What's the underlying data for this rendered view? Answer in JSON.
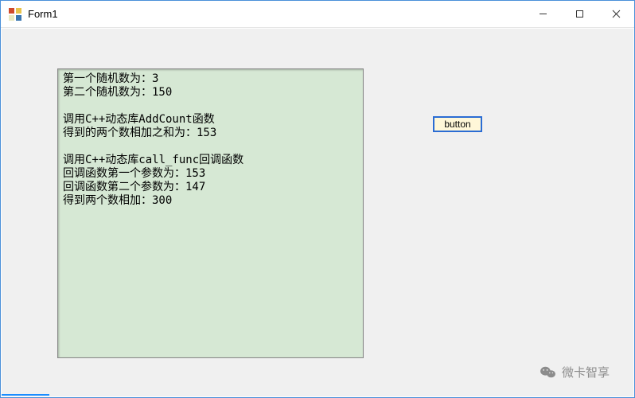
{
  "window": {
    "title": "Form1"
  },
  "output": {
    "lines": [
      "第一个随机数为：3",
      "第二个随机数为：150",
      "",
      "调用C++动态库AddCount函数",
      "得到的两个数相加之和为：153",
      "",
      "调用C++动态库call_func回调函数",
      "回调函数第一个参数为：153",
      "回调函数第二个参数为：147",
      "得到两个数相加：300"
    ]
  },
  "button": {
    "label": "button"
  },
  "watermark": {
    "text": "微卡智享"
  }
}
